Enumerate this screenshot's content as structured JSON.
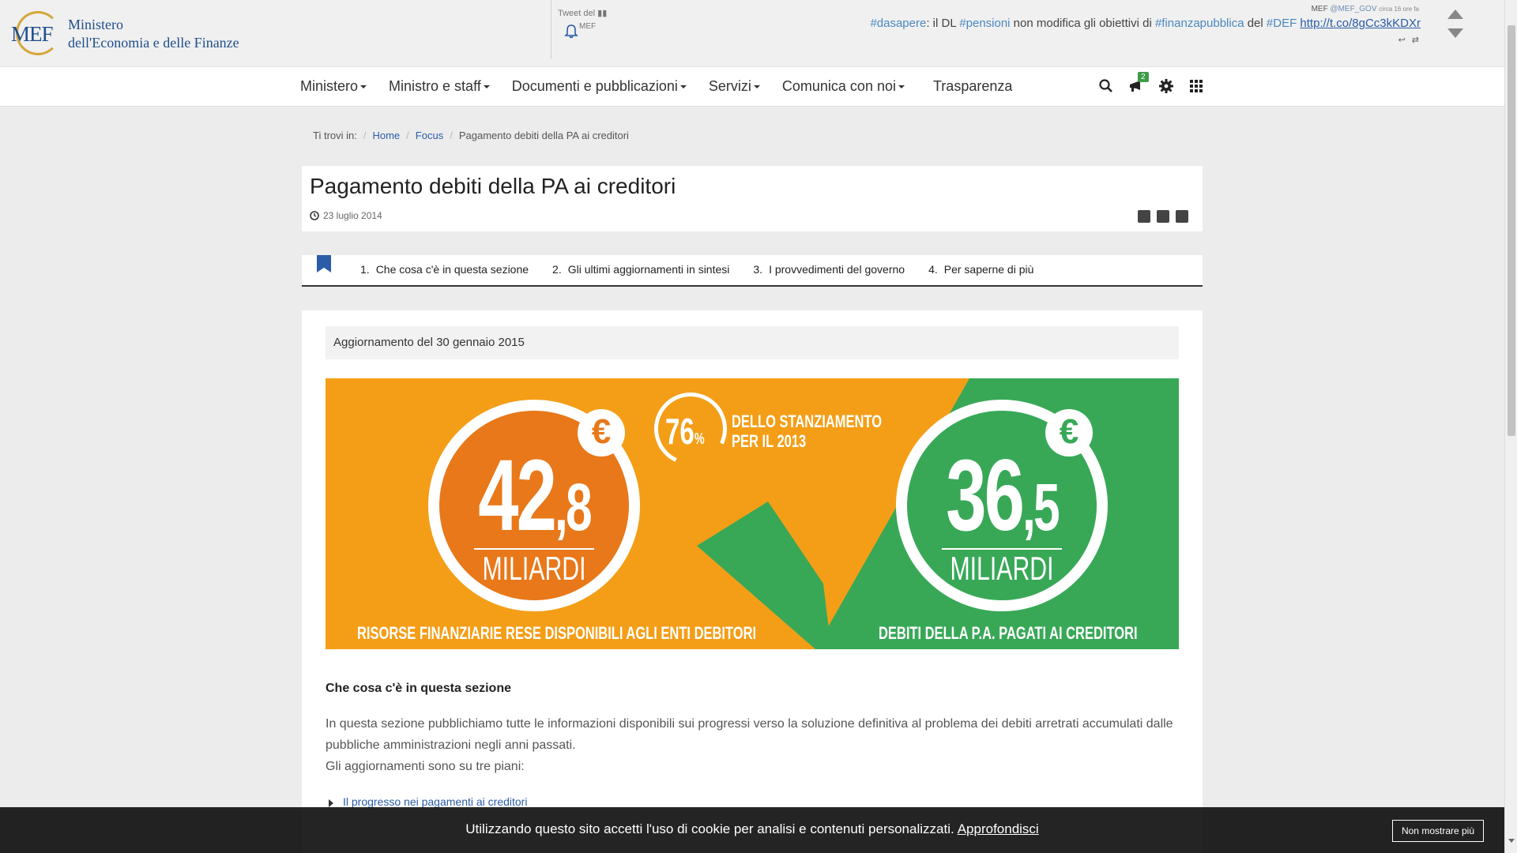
{
  "header": {
    "logo_mark": "MEF",
    "logo_line1": "Ministero",
    "logo_line2": "dell'Economia e delle Finanze",
    "tweet_label": "Tweet del",
    "tweet_user_short": "MEF",
    "tweet_author": "MEF",
    "tweet_handle": "@MEF_GOV",
    "tweet_ago": "circa 16 ore fa",
    "tweet": {
      "tag1": "#dasapere",
      "text1": ": il DL ",
      "tag2": "#pensioni",
      "text2": " non modifica gli obiettivi di ",
      "tag3": "#finanzapubblica",
      "text3": " del ",
      "tag4": "#DEF",
      "link": "http://t.co/8gCc3kKDXr"
    }
  },
  "nav": {
    "items": [
      {
        "label": "Ministero"
      },
      {
        "label": "Ministro e staff"
      },
      {
        "label": "Documenti e pubblicazioni"
      },
      {
        "label": "Servizi"
      },
      {
        "label": "Comunica con noi"
      },
      {
        "label": "Trasparenza"
      }
    ],
    "notifications_count": "2"
  },
  "breadcrumb": {
    "prefix": "Ti trovi in:",
    "home": "Home",
    "focus": "Focus",
    "current": "Pagamento debiti della PA ai creditori"
  },
  "page": {
    "title": "Pagamento debiti della PA ai creditori",
    "date": "23 luglio 2014"
  },
  "tabs": [
    {
      "num": "1.",
      "label": "Che cosa c'è in questa sezione"
    },
    {
      "num": "2.",
      "label": "Gli ultimi aggiornamenti in sintesi"
    },
    {
      "num": "3.",
      "label": "I provvedimenti del governo"
    },
    {
      "num": "4.",
      "label": "Per saperne di più"
    }
  ],
  "content": {
    "update": "Aggiornamento del 30 gennaio 2015",
    "infographic": {
      "left_int": "42",
      "left_dec": ",8",
      "left_unit": "MILIARDI",
      "left_caption": "RISORSE FINANZIARIE RESE DISPONIBILI AGLI ENTI DEBITORI",
      "pct_value": "76",
      "pct_sign": "%",
      "pct_line1": "DELLO STANZIAMENTO",
      "pct_line2": "PER IL 2013",
      "right_int": "36",
      "right_dec": ",5",
      "right_unit": "MILIARDI",
      "right_caption": "DEBITI DELLA P.A. PAGATI AI CREDITORI",
      "euro_symbol": "€",
      "colors": {
        "orange": "#f49e17",
        "dark_orange": "#e8781a",
        "green": "#38a857"
      }
    },
    "section_heading": "Che cosa c'è in questa sezione",
    "section_text1": "In questa sezione pubblichiamo tutte le informazioni disponibili sui progressi verso la soluzione definitiva al problema dei debiti arretrati accumulati dalle pubbliche amministrazioni negli anni passati.",
    "section_text2": "Gli aggiornamenti sono su tre piani:",
    "links": [
      {
        "label": "Il progresso nei pagamenti ai creditori"
      }
    ]
  },
  "cookie": {
    "text": "Utilizzando questo sito accetti l'uso di cookie per analisi e contenuti personalizzati.",
    "link": "Approfondisci",
    "button": "Non mostrare più"
  }
}
